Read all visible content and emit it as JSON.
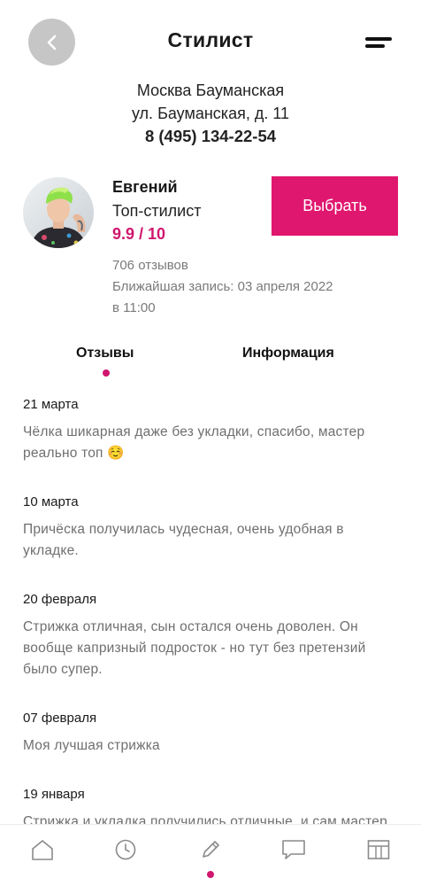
{
  "header": {
    "title": "Стилист"
  },
  "salon": {
    "station": "Москва Бауманская",
    "address": "ул. Бауманская, д. 11",
    "phone": "8 (495) 134-22-54"
  },
  "stylist": {
    "name": "Евгений",
    "role": "Топ-стилист",
    "rating": "9.9 / 10",
    "reviews_count": "706 отзывов",
    "next_booking_line1": "Ближайшая запись: 03 апреля 2022",
    "next_booking_line2": "в 11:00",
    "select_label": "Выбрать"
  },
  "tabs": [
    {
      "label": "Отзывы",
      "active": true
    },
    {
      "label": "Информация",
      "active": false
    }
  ],
  "reviews": [
    {
      "date": "21 марта",
      "text": "Чёлка шикарная даже без укладки, спасибо, мастер реально топ ☺️"
    },
    {
      "date": "10 марта",
      "text": "Причёска получилась чудесная, очень удобная в укладке."
    },
    {
      "date": "20 февраля",
      "text": "Стрижка отличная, сын остался очень доволен. Он вообще капризный подросток - но тут без претензий было супер."
    },
    {
      "date": "07 февраля",
      "text": "Моя лучшая стрижка"
    },
    {
      "date": "19 января",
      "text": "Стрижка и укладка получились отличные, и сам мастер очень приятный."
    }
  ],
  "nav": {
    "items": [
      "home-icon",
      "clock-icon",
      "pencil-icon",
      "chat-icon",
      "grid-icon"
    ],
    "active_index": 2
  },
  "colors": {
    "accent": "#e0176f",
    "rating": "#d0166f",
    "back_button": "#c6c6c6"
  }
}
